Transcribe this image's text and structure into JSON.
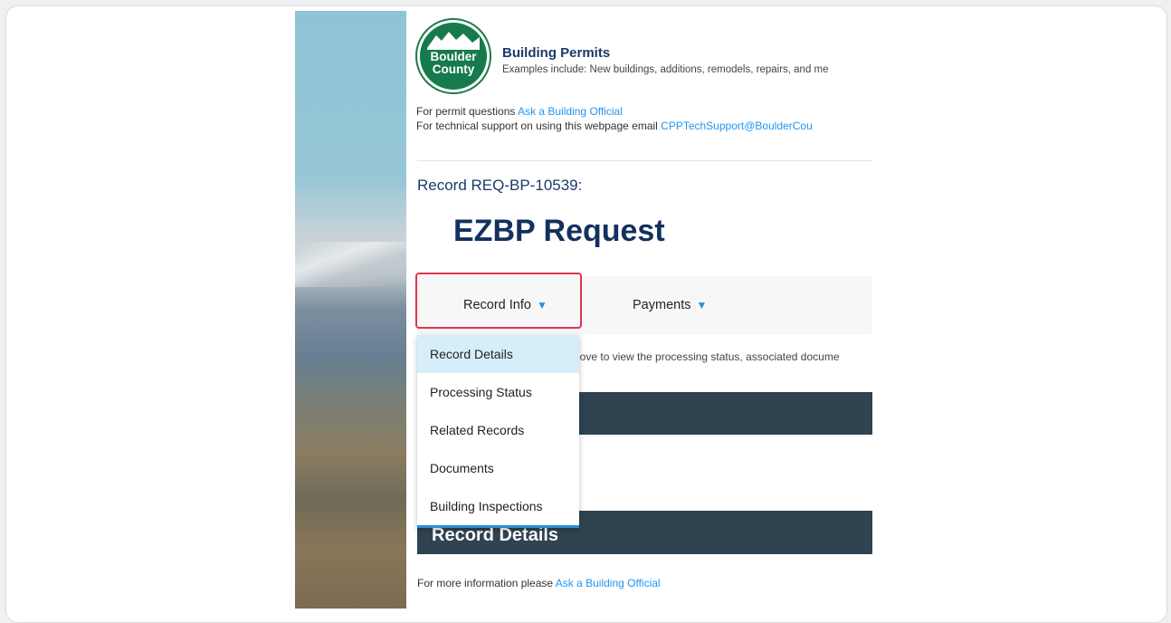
{
  "header": {
    "logo_line1": "Boulder",
    "logo_line2": "County",
    "title": "Building Permits",
    "description": "Examples include: New buildings, additions, remodels, repairs, and me"
  },
  "help": {
    "permit_prefix": "For permit questions ",
    "permit_link": "Ask a Building Official",
    "tech_prefix": "For technical support on using this webpage email ",
    "tech_link": "CPPTechSupport@BoulderCou"
  },
  "record": {
    "id_label": "Record REQ-BP-10539:",
    "title": "EZBP Request"
  },
  "tabs": [
    {
      "label": "Record Info"
    },
    {
      "label": "Payments"
    }
  ],
  "hint_text": "bove to view the processing status, associated docume",
  "dropdown": {
    "items": [
      {
        "label": "Record Details",
        "active": true
      },
      {
        "label": "Processing Status"
      },
      {
        "label": "Related Records"
      },
      {
        "label": "Documents"
      },
      {
        "label": "Building Inspections"
      }
    ]
  },
  "section": {
    "title": "Record Details"
  },
  "footer": {
    "prefix": "For more information please ",
    "link": "Ask a Building Official"
  },
  "colors": {
    "accent": "#2a8fdc",
    "highlight": "#e0344f",
    "dark_bar": "#2f4350",
    "title": "#13315e"
  }
}
